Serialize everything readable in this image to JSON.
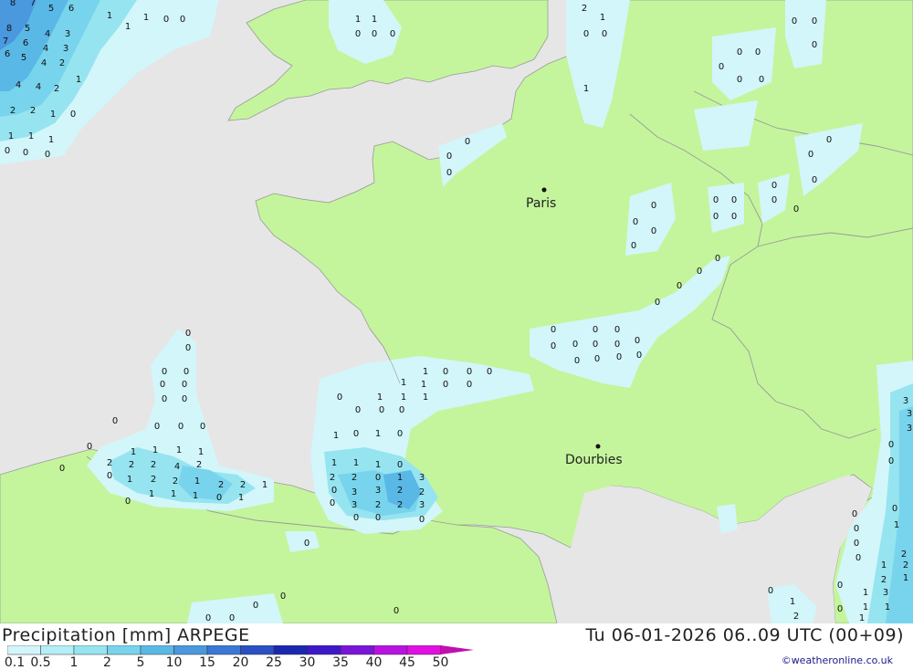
{
  "title": "Precipitation [mm] ARPEGE",
  "run_info": "Tu 06-01-2026 06..09 UTC (00+09)",
  "credit": "©weatheronline.co.uk",
  "legend": {
    "ticks": [
      "0.1",
      "0.5",
      "1",
      "2",
      "5",
      "10",
      "15",
      "20",
      "25",
      "30",
      "35",
      "40",
      "45",
      "50"
    ],
    "colors": [
      "#d2f6fa",
      "#b4eef6",
      "#96e4f0",
      "#78d4ec",
      "#5ab8e6",
      "#4a98de",
      "#3a78d4",
      "#2a50c4",
      "#1a28b0",
      "#3c18c8",
      "#7a14d8",
      "#b812e0",
      "#e010e0",
      "#c010b0"
    ]
  },
  "colors": {
    "sea": "#e6e6e6",
    "land": "#c4f59c",
    "border": "#9a9a9a"
  },
  "cities": [
    {
      "name": "Paris"
    },
    {
      "name": "Dourbies"
    }
  ],
  "precip_labels": [
    "0",
    "0",
    "0",
    "0",
    "0",
    "0",
    "0",
    "0",
    "0",
    "0",
    "1",
    "1",
    "1",
    "1",
    "1",
    "1",
    "1",
    "2",
    "2",
    "2",
    "2",
    "2",
    "3",
    "3",
    "3",
    "3",
    "4",
    "4",
    "5",
    "5",
    "6",
    "6",
    "7"
  ]
}
